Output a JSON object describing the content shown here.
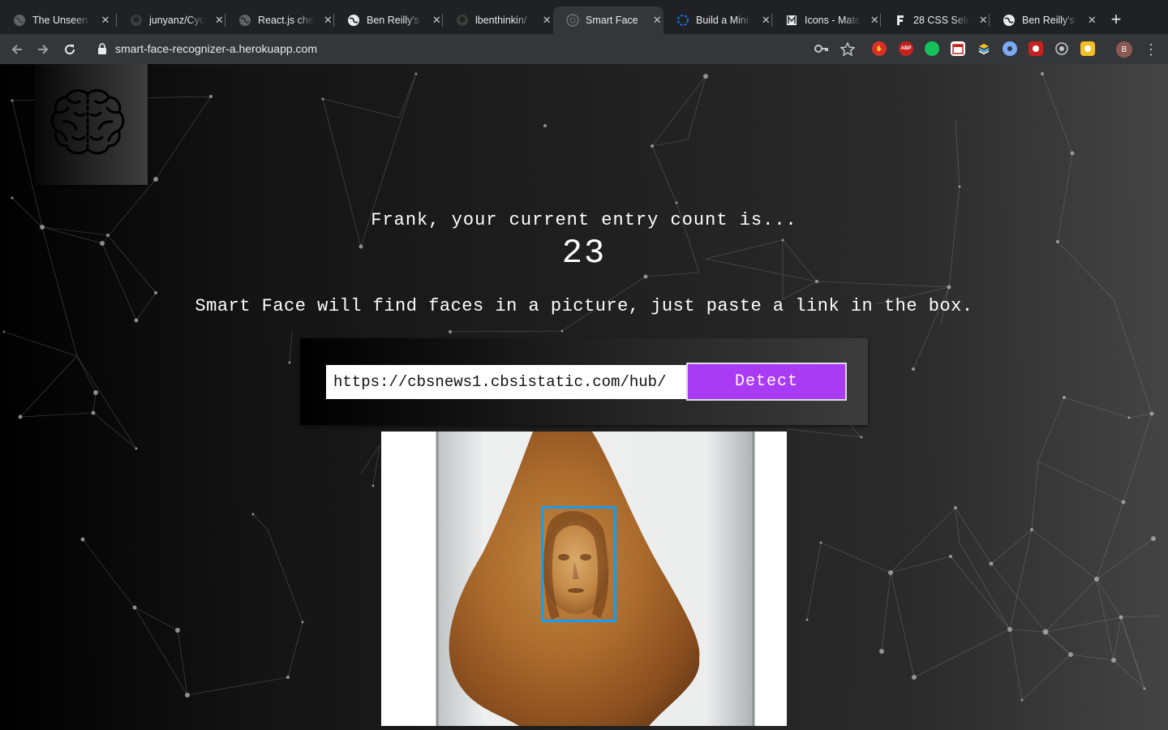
{
  "browser": {
    "tabs": [
      {
        "title": "The Unseen",
        "icon": "globe-icon",
        "active": false
      },
      {
        "title": "junyanz/Cyc",
        "icon": "github-icon",
        "active": false
      },
      {
        "title": "React.js che",
        "icon": "globe-icon",
        "active": false
      },
      {
        "title": "Ben Reilly's",
        "icon": "globe-icon",
        "active": false
      },
      {
        "title": "lbenthinkin/",
        "icon": "github-icon",
        "active": false
      },
      {
        "title": "Smart Face",
        "icon": "globe-icon",
        "active": true
      },
      {
        "title": "Build a Mini",
        "icon": "spinner-icon",
        "active": false
      },
      {
        "title": "Icons - Mate",
        "icon": "material-icon",
        "active": false
      },
      {
        "title": "28 CSS Sele",
        "icon": "letter-f-icon",
        "active": false
      },
      {
        "title": "Ben Reilly's",
        "icon": "globe-icon",
        "active": false
      }
    ],
    "close_glyph": "✕",
    "new_tab_glyph": "+",
    "url": "smart-face-recognizer-a.herokuapp.com",
    "extensions": {
      "adblock": "ABP",
      "grammarly": "",
      "avatar_letter": "B"
    }
  },
  "app": {
    "greeting": "Frank, your current entry count is...",
    "entry_count": "23",
    "description": "Smart Face will find faces in a picture, just paste a link in the box.",
    "image_url_value": "https://cbsnews1.cbsistatic.com/hub/",
    "detect_label": "Detect",
    "face_box_color": "#149df2",
    "detect_button_color": "#a83bf3"
  }
}
